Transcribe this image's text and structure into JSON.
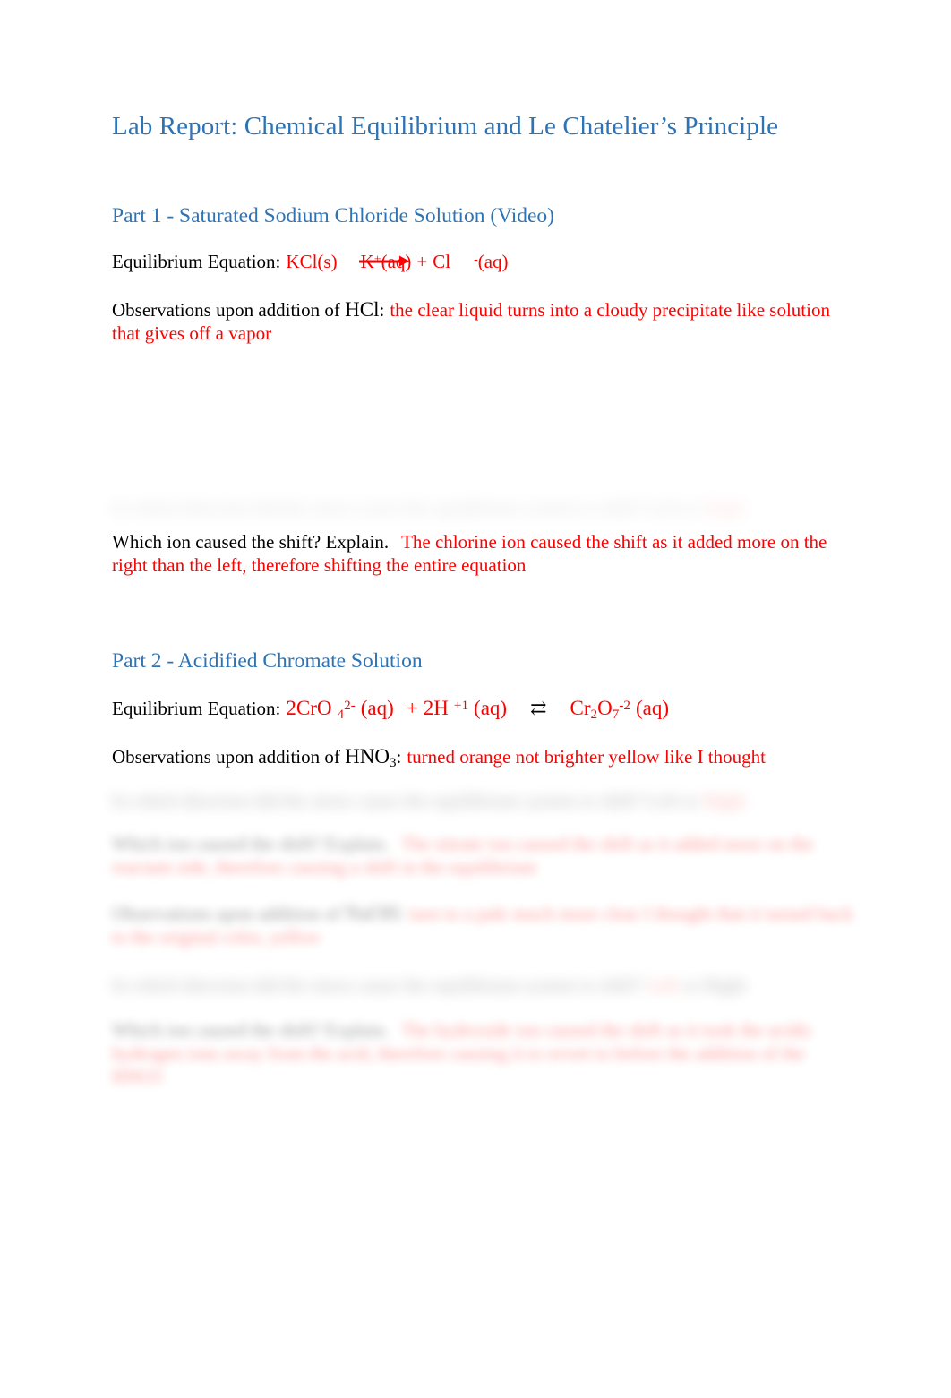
{
  "document": {
    "title": "Lab Report: Chemical Equilibrium and Le Chatelier’s Principle",
    "colors": {
      "heading_blue": "#2E74B5",
      "answer_red": "#FF0000",
      "body_black": "#000000",
      "page_background": "#FFFFFF"
    }
  },
  "part1": {
    "heading": "Part 1 - Saturated Sodium Chloride Solution (Video)",
    "equation_label": "Equilibrium Equation:",
    "equation": {
      "reactant": "KCl(s)",
      "arrow": "⟶",
      "product1_symbol": "K",
      "product1_charge": "+",
      "product1_state": "(aq)",
      "plus": "+",
      "product2_symbol": "Cl",
      "product2_charge": "-",
      "product2_state": "(aq)",
      "full_text": "KCl(s) ⟶ K+(aq) + Cl -(aq)"
    },
    "observation_label_prefix": "Observations upon addition of ",
    "observation_reagent": "HCl",
    "observation_colon": ":",
    "observation_answer": "the clear liquid turns into a cloudy precipitate like solution that gives off a vapor",
    "direction_question": "In which direction did the stress cause the equilibrium system to shift? Left or",
    "direction_answer": "Right",
    "ion_question": "Which ion caused the shift? Explain.",
    "ion_answer": "The chlorine ion caused the shift as it added more on the right than the left, therefore shifting the entire equation"
  },
  "part2": {
    "heading": "Part 2 - Acidified Chromate Solution",
    "equation_label": "Equilibrium Equation:",
    "equation": {
      "reactant1_coefficient_symbol": "2CrO",
      "reactant1_subscript": "4",
      "reactant1_charge": "2-",
      "reactant1_state": "(aq)",
      "plus": "+",
      "reactant2_symbol": "2H",
      "reactant2_charge": "+1",
      "reactant2_state": "(aq)",
      "arrow": "⇄",
      "product_symbol_a": "Cr",
      "product_subscript_a": "2",
      "product_symbol_b": "O",
      "product_subscript_b": "7",
      "product_charge": "-2",
      "product_state": "(aq)",
      "full_text": "2CrO4 2- (aq) + 2H +1 (aq) ⇄ Cr2O7 -2 (aq)"
    },
    "observation_label_prefix": "Observations upon addition of ",
    "observation_reagent_a": "HNO",
    "observation_reagent_a_sub": "3",
    "observation_colon": ":",
    "observation_answer_a": "turned orange not brighter yellow like I thought",
    "direction_question_a": "In which direction did the stress cause the equilibrium system to shift? Left or",
    "direction_answer_a": "Right",
    "ion_question_a": "Which ion caused the shift? Explain.",
    "ion_answer_a": "The nitrate ion caused the shift as it added more on the reactant side, therefore causing a shift in the equilibrium",
    "observation_label_prefix_b": "Observations upon addition of ",
    "observation_reagent_b": "NaOH",
    "observation_colon_b": ":",
    "observation_answer_b": "turn to a pale much more clear I thought that it turned back to the original color, yellow",
    "direction_question_b_pre": "In which direction did the stress cause the equilibrium system to shift?",
    "direction_answer_b": "Left",
    "direction_question_b_post": "or Right",
    "ion_question_b": "Which ion caused the shift? Explain.",
    "ion_answer_b": "The hydroxide ion caused the shift as it took the acidic hydrogen ions away from the acid, therefore causing it to revert to before the addition of the HNO3"
  }
}
